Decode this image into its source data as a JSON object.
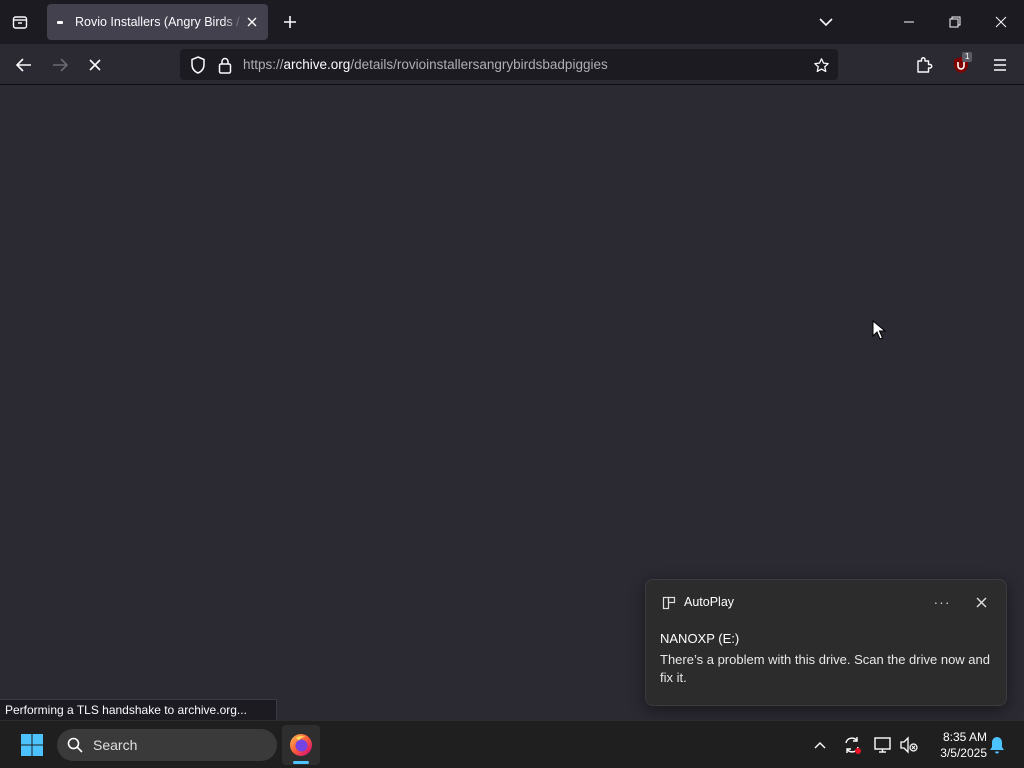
{
  "browser": {
    "tab": {
      "title": "Rovio Installers (Angry Birds / Bad Piggies)"
    },
    "url": {
      "scheme": "https://",
      "domain": "archive.org",
      "path": "/details/rovioinstallersangrybirdsbadpiggies"
    },
    "extension_badge": "1",
    "status_text": "Performing a TLS handshake to archive.org..."
  },
  "notification": {
    "app": "AutoPlay",
    "more_label": "···",
    "title": "NANOXP (E:)",
    "body": "There’s a problem with this drive.  Scan the drive now and fix it."
  },
  "taskbar": {
    "search_placeholder": "Search",
    "time": "8:35 AM",
    "date": "3/5/2025"
  },
  "colors": {
    "content_bg": "#2b2a33",
    "titlebar_bg": "#1c1b22",
    "taskbar_bg": "#1f1f1f",
    "accent": "#4cc2ff"
  }
}
